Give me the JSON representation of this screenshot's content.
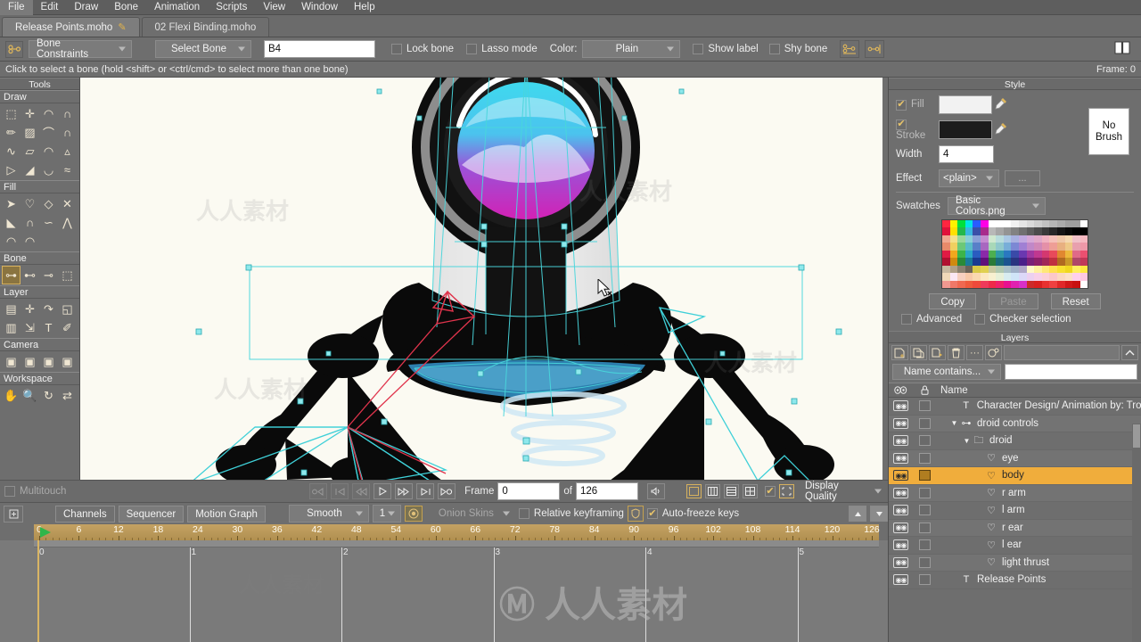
{
  "menubar": {
    "items": [
      "File",
      "Edit",
      "Draw",
      "Bone",
      "Animation",
      "Scripts",
      "View",
      "Window",
      "Help"
    ]
  },
  "tabs": [
    {
      "label": "Release Points.moho",
      "modified_icon": "pencil-icon",
      "active": true
    },
    {
      "label": "02 Flexi Binding.moho",
      "modified_icon": "",
      "active": false
    }
  ],
  "options_toolbar": {
    "tool_icon": "bone-constraints-icon",
    "mode_combo": "Bone Constraints",
    "action_combo": "Select Bone",
    "bone_name_value": "B4",
    "lock_bone_label": "Lock bone",
    "lock_bone_checked": false,
    "lasso_mode_label": "Lasso mode",
    "lasso_mode_checked": false,
    "color_label": "Color:",
    "color_combo": "Plain",
    "show_label_label": "Show label",
    "show_label_checked": false,
    "shy_bone_label": "Shy bone",
    "shy_bone_checked": false,
    "extra_icons": [
      "bone-flex-icon",
      "bone-scale-icon"
    ],
    "help_icon": "book-icon"
  },
  "hintbar": {
    "message": "Click to select a bone (hold <shift> or <ctrl/cmd> to select more than one bone)",
    "frame_status": "Frame: 0"
  },
  "tools_panel": {
    "title": "Tools",
    "groups": [
      {
        "name": "Draw",
        "icons": [
          "select-points-icon",
          "transform-points-icon",
          "curvature-icon",
          "magnet-icon",
          "freehand-icon",
          "shape-blend-icon",
          "add-point-icon",
          "scissors-icon",
          "noise-icon",
          "extrude-icon",
          "curve-profile-icon",
          "perspective-points-icon",
          "shear-points-icon",
          "bend-points-icon",
          "wide-curve-icon",
          "scatter-brush-icon"
        ]
      },
      {
        "name": "Fill",
        "icons": [
          "select-shape-icon",
          "create-shape-icon",
          "paint-bucket-icon",
          "blob-brush-icon",
          "delete-edge-icon",
          "line-width-icon",
          "hide-edge-icon",
          "stroke-exposure-icon",
          "curve-exposure-icon",
          "gradient-icon"
        ]
      },
      {
        "name": "Bone",
        "icons": [
          "bone-constraints-icon",
          "manipulate-bones-icon",
          "bone-strength-icon",
          "select-bone-region-icon"
        ]
      },
      {
        "name": "Layer",
        "icons": [
          "layer-transform-icon",
          "add-layer-icon",
          "rotate-layer-icon",
          "shear-layer-icon",
          "flip-layer-icon",
          "follow-path-icon",
          "text-tool-icon",
          "eyedropper-icon"
        ]
      },
      {
        "name": "Camera",
        "icons": [
          "track-camera-icon",
          "zoom-camera-icon",
          "roll-camera-icon",
          "pan-tilt-camera-icon"
        ]
      },
      {
        "name": "Workspace",
        "icons": [
          "pan-workspace-icon",
          "zoom-workspace-icon",
          "rotate-workspace-icon",
          "orbit-workspace-icon"
        ]
      }
    ],
    "selected_tool": "bone-constraints-icon"
  },
  "style_panel": {
    "title": "Style",
    "fill_label": "Fill",
    "fill_checked": true,
    "fill_color": "#f2f2f2",
    "stroke_label": "Stroke",
    "stroke_checked": true,
    "stroke_color": "#1c1c1c",
    "no_brush_label": "No Brush",
    "width_label": "Width",
    "width_value": "4",
    "effect_label": "Effect",
    "effect_value": "<plain>",
    "effect_more_label": "...",
    "swatches_label": "Swatches",
    "swatches_value": "Basic Colors.png",
    "copy_label": "Copy",
    "paste_label": "Paste",
    "reset_label": "Reset",
    "advanced_label": "Advanced",
    "advanced_checked": false,
    "checker_label": "Checker selection",
    "checker_checked": false,
    "swatch_rows": [
      [
        "#ff2640",
        "#fff200",
        "#00e03c",
        "#00e6e6",
        "#2a5cff",
        "#ff00e6",
        "#ffffff",
        "#ffffff",
        "#ffffff",
        "#f2f2f2",
        "#e6e6e6",
        "#dadada",
        "#cecece",
        "#c2c2c2",
        "#b6b6b6",
        "#aaaaaa",
        "#9e9e9e",
        "#9e9e9e",
        "#ffffff"
      ],
      [
        "#e0123a",
        "#ffe000",
        "#24b84c",
        "#3ab7e0",
        "#3a4fa8",
        "#a82a8c",
        "#b8b8b8",
        "#a6a6a6",
        "#949494",
        "#828282",
        "#707070",
        "#5e5e5e",
        "#4c4c4c",
        "#3a3a3a",
        "#282828",
        "#161616",
        "#0a0a0a",
        "#000000",
        "#000000"
      ],
      [
        "#f0a890",
        "#f5e08a",
        "#9ad89a",
        "#8ad0d8",
        "#8aa0d8",
        "#c48ad0",
        "#cfe8cf",
        "#b8dcdc",
        "#aac8e4",
        "#a8b0e0",
        "#c0a8e0",
        "#d6a8d6",
        "#e0a8c8",
        "#f0b0c0",
        "#f5c0b8",
        "#f0c8a8",
        "#f5d8b0",
        "#f0c0c8",
        "#f5b8c0"
      ],
      [
        "#e88a6a",
        "#f0d060",
        "#6cc878",
        "#58bcc8",
        "#5880c8",
        "#a868c0",
        "#a8d8b8",
        "#90c8cc",
        "#78aed8",
        "#7c88d4",
        "#a080d4",
        "#c088c8",
        "#d088b8",
        "#e490a8",
        "#ee9e96",
        "#e8b080",
        "#eec888",
        "#e8a0ae",
        "#ee98a8"
      ],
      [
        "#e01b44",
        "#f2a81e",
        "#3cb44a",
        "#2aa8c8",
        "#2a5cc0",
        "#8a2aa8",
        "#4caf50",
        "#2f9aa8",
        "#2a78c0",
        "#3a4aa8",
        "#6a38b0",
        "#a038a0",
        "#c03890",
        "#d43870",
        "#e84a5a",
        "#e08830",
        "#ecb83c",
        "#e06a88",
        "#ea5070"
      ],
      [
        "#b01030",
        "#d08a10",
        "#2a8a38",
        "#1a7a98",
        "#1a3a90",
        "#60107a",
        "#2a7a38",
        "#1a6a78",
        "#1a5490",
        "#2a3480",
        "#4a2088",
        "#7a2078",
        "#8c2068",
        "#a02858",
        "#c03040",
        "#b06a20",
        "#c89828",
        "#b04868",
        "#c03858"
      ],
      [
        "#c8b8a0",
        "#b0a088",
        "#8a8070",
        "#6a6258",
        "#d8c848",
        "#e0d050",
        "#c8c8a0",
        "#b0c8b0",
        "#a8c0c8",
        "#a0b0c8",
        "#b0a8c8",
        "#fff8c8",
        "#fff0a0",
        "#ffe878",
        "#ffe050",
        "#f8e030",
        "#f0d820",
        "#fff060",
        "#ffe840"
      ],
      [
        "#f0d8b8",
        "#fce8f4",
        "#f8d0c0",
        "#f8c8a8",
        "#fad8b0",
        "#fce8c0",
        "#f8f0d0",
        "#e8f0d8",
        "#d8ecf0",
        "#d0e4f8",
        "#dcd8f8",
        "#ecd0f0",
        "#f8d0e8",
        "#fcd0d8",
        "#fcc8c8",
        "#fcd8c0",
        "#fce0c8",
        "#ffd0ec",
        "#ffc8e0"
      ],
      [
        "#f09890",
        "#f07868",
        "#f06850",
        "#ef5a3c",
        "#f04a3a",
        "#ef3a5a",
        "#ee2a4a",
        "#f0206a",
        "#e81090",
        "#e020b0",
        "#d830c8",
        "#cc2a2a",
        "#d82020",
        "#e83030",
        "#f04040",
        "#e02828",
        "#d01818",
        "#c81010",
        "#ffffff"
      ]
    ]
  },
  "layers_panel": {
    "title": "Layers",
    "toolbar_icons": [
      "new-layer-icon",
      "duplicate-layer-icon",
      "new-group-icon",
      "delete-layer-icon",
      "more-options-icon",
      "layer-settings-icon"
    ],
    "collapse_icon": "chevron-up-icon",
    "filter_combo": "Name contains...",
    "filter_value": "",
    "col_visible_icon": "eye-icon",
    "col_lock_icon": "lock-icon",
    "col_name": "Name",
    "rows": [
      {
        "name": "Character Design/ Animation by: Tro",
        "type_icon": "text-layer-icon",
        "indent": 1,
        "expander": "",
        "selected": false
      },
      {
        "name": "droid controls",
        "type_icon": "bone-layer-icon",
        "indent": 1,
        "expander": "▼",
        "selected": false
      },
      {
        "name": "droid",
        "type_icon": "group-layer-icon",
        "indent": 2,
        "expander": "▼",
        "selected": false
      },
      {
        "name": "eye",
        "type_icon": "vector-layer-icon",
        "indent": 3,
        "expander": "",
        "selected": false
      },
      {
        "name": "body",
        "type_icon": "vector-layer-icon",
        "indent": 3,
        "expander": "",
        "selected": true
      },
      {
        "name": "r arm",
        "type_icon": "vector-layer-icon",
        "indent": 3,
        "expander": "",
        "selected": false
      },
      {
        "name": "l arm",
        "type_icon": "vector-layer-icon",
        "indent": 3,
        "expander": "",
        "selected": false
      },
      {
        "name": "r ear",
        "type_icon": "vector-layer-icon",
        "indent": 3,
        "expander": "",
        "selected": false
      },
      {
        "name": "l ear",
        "type_icon": "vector-layer-icon",
        "indent": 3,
        "expander": "",
        "selected": false
      },
      {
        "name": "light thrust",
        "type_icon": "vector-layer-icon",
        "indent": 3,
        "expander": "",
        "selected": false
      },
      {
        "name": "Release Points",
        "type_icon": "text-layer-icon",
        "indent": 1,
        "expander": "",
        "selected": false
      }
    ]
  },
  "playback_bar": {
    "multitouch_label": "Multitouch",
    "multitouch_checked": false,
    "buttons": [
      "rewind-to-start-icon",
      "previous-keyframe-icon",
      "step-back-icon",
      "play-icon",
      "fast-forward-icon",
      "step-to-end-icon",
      "loop-icon"
    ],
    "frame_label": "Frame",
    "frame_value": "0",
    "of_label": "of",
    "total_frames_value": "126",
    "audio_icon": "speaker-icon",
    "quality_buttons": [
      "quality-low-icon",
      "quality-medium-icon",
      "quality-high-icon",
      "quality-full-icon"
    ],
    "quality_checked": true,
    "crop_icon": "crop-icon",
    "display_quality_combo": "Display Quality"
  },
  "channels_bar": {
    "tabs": [
      "Channels",
      "Sequencer",
      "Motion Graph"
    ],
    "interpolation_combo": "Smooth",
    "interp_amount": "1",
    "onion_toggle_icon": "onion-icon",
    "onion_skins_combo": "Onion Skins",
    "relative_keyframing_label": "Relative keyframing",
    "relative_keyframing_checked": false,
    "freeze_icon": "shield-icon",
    "auto_freeze_label": "Auto-freeze keys",
    "auto_freeze_checked": true,
    "scroll_up_icon": "scroll-up-icon",
    "scroll_down_icon": "scroll-down-icon"
  },
  "timeline": {
    "frame_ticks": [
      0,
      6,
      12,
      18,
      24,
      30,
      36,
      42,
      48,
      54,
      60,
      66,
      72,
      78,
      84,
      90,
      96,
      102,
      108,
      114,
      120,
      126
    ],
    "current_frame": 0,
    "keyframe_markers": [
      "0",
      "1",
      "2",
      "3",
      "4",
      "5"
    ],
    "playhead_frame": 0
  },
  "colors": {
    "accent": "#f0ad3c",
    "panel_bg": "#6e6e6e",
    "canvas_bg": "#fbfaf2",
    "ruler_band": "#c4a263",
    "bone_cyan": "#3fd0d8",
    "bone_red": "#e0344c"
  },
  "watermark": {
    "text_main": "人人素材",
    "text_sub": "M"
  }
}
